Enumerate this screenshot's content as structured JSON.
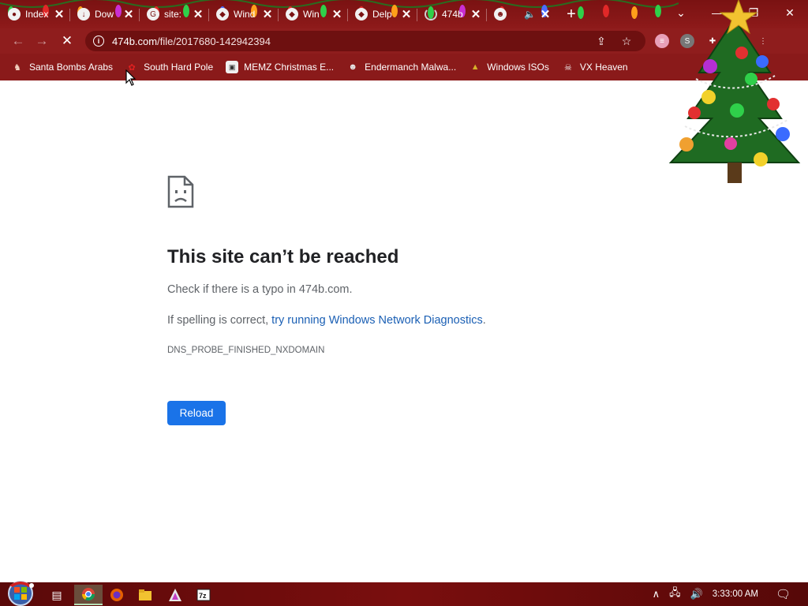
{
  "browser": {
    "tabs": [
      {
        "title": "Index",
        "favicon": "chrome-icon",
        "active": false
      },
      {
        "title": "Dow",
        "favicon": "download-icon",
        "active": false
      },
      {
        "title": "site:",
        "favicon": "google-icon",
        "active": false
      },
      {
        "title": "Wind",
        "favicon": "app-icon",
        "active": false
      },
      {
        "title": "Win",
        "favicon": "app-icon",
        "active": false
      },
      {
        "title": "Delp",
        "favicon": "app-icon",
        "active": false
      },
      {
        "title": "474b",
        "favicon": "loading-icon",
        "active": true
      },
      {
        "title": "",
        "favicon": "panda-icon",
        "active": false
      }
    ],
    "new_tab_label": "+",
    "url": "474b.com/file/2017680-142942394",
    "url_host": "474b.com",
    "url_path": "/file/2017680-142942394",
    "bookmarks": [
      {
        "label": "Santa Bombs Arabs",
        "icon": "santa-icon"
      },
      {
        "label": "South Hard Pole",
        "icon": "paw-icon"
      },
      {
        "label": "MEMZ Christmas E...",
        "icon": "memz-icon"
      },
      {
        "label": "Endermanch Malwa...",
        "icon": "raccoon-icon"
      },
      {
        "label": "Windows ISOs",
        "icon": "tree-icon"
      },
      {
        "label": "VX Heaven",
        "icon": "skull-icon"
      }
    ],
    "colors": {
      "chrome": "#8f1d1d",
      "tabbar": "#7a1212",
      "omnibox": "#6e1010"
    }
  },
  "error": {
    "title": "This site can’t be reached",
    "line1": "Check if there is a typo in 474b.com.",
    "line2_prefix": "If spelling is correct, ",
    "line2_link": "try running Windows Network Diagnostics",
    "line2_suffix": ".",
    "code": "DNS_PROBE_FINISHED_NXDOMAIN",
    "reload_label": "Reload",
    "accent": "#1a73e8"
  },
  "taskbar": {
    "clock": "3:33:00 AM",
    "apps": [
      "task-view-icon",
      "chrome-icon",
      "firefox-icon",
      "file-explorer-icon",
      "memz-icon",
      "7zip-icon"
    ]
  }
}
